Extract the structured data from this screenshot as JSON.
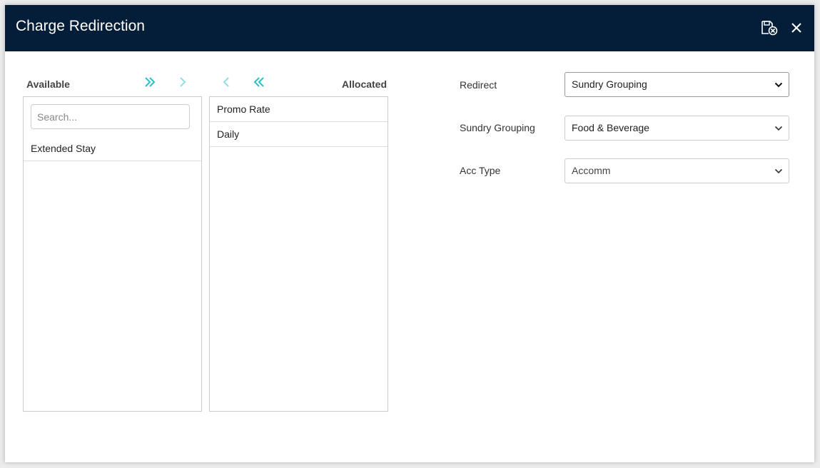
{
  "dialog": {
    "title": "Charge Redirection"
  },
  "available": {
    "heading": "Available",
    "search_placeholder": "Search...",
    "items": [
      "Extended Stay"
    ]
  },
  "allocated": {
    "heading": "Allocated",
    "items": [
      "Promo Rate",
      "Daily"
    ]
  },
  "fields": {
    "redirect": {
      "label": "Redirect",
      "value": "Sundry Grouping"
    },
    "sundry_grouping": {
      "label": "Sundry Grouping",
      "value": "Food & Beverage"
    },
    "acc_type": {
      "label": "Acc Type",
      "value": "Accomm"
    }
  },
  "icons": {
    "move_all_right": "double-chevron-right-icon",
    "move_right": "chevron-right-icon",
    "move_left": "chevron-left-icon",
    "move_all_left": "double-chevron-left-icon",
    "save_close": "save-cancel-icon",
    "close": "close-icon"
  },
  "colors": {
    "header_bg": "#041e3a",
    "accent_teal": "#2bc0c7",
    "accent_teal_light": "#8fdde0"
  }
}
